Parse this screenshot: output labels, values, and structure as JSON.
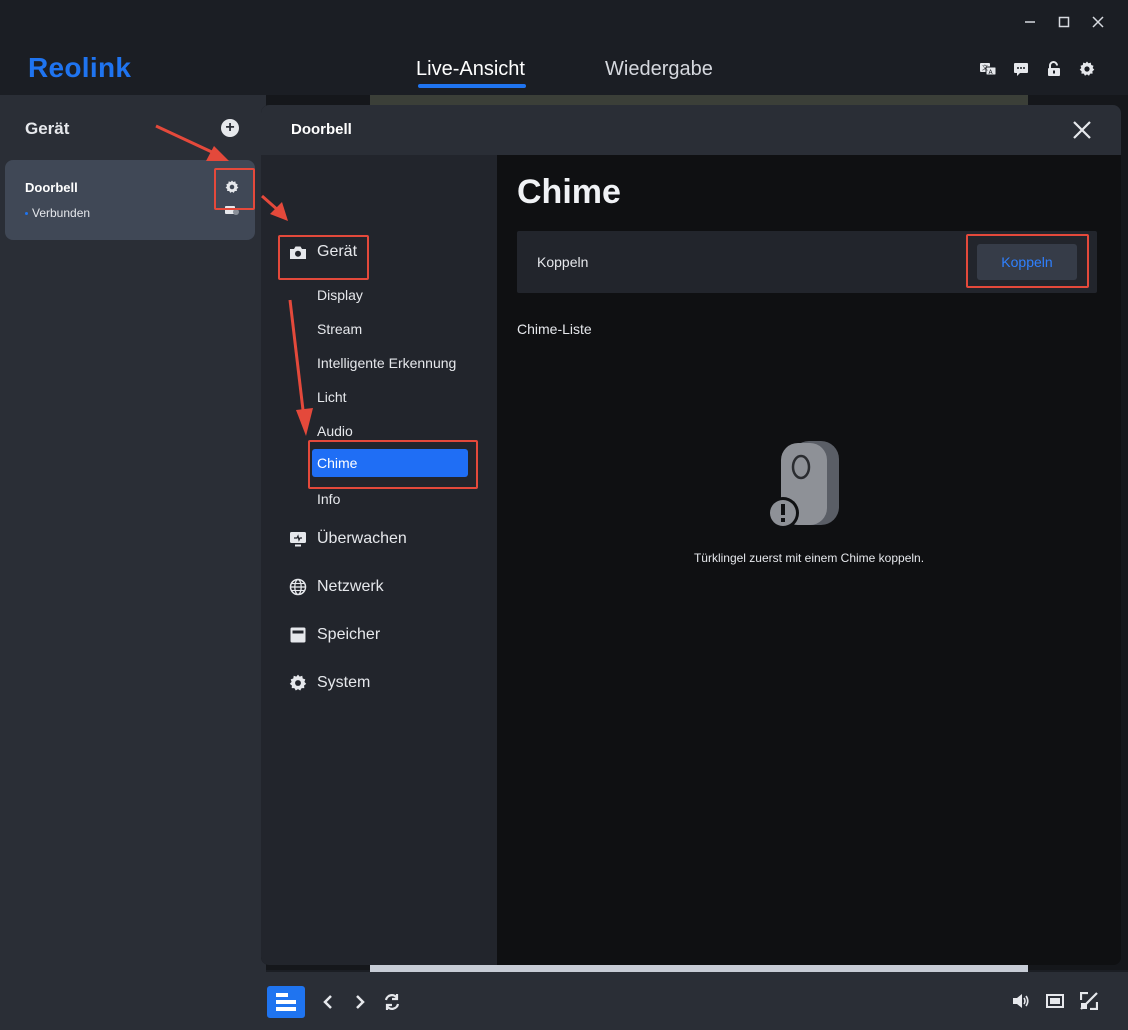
{
  "app": {
    "logo": "Reolink",
    "tabs": [
      {
        "label": "Live-Ansicht",
        "active": true
      },
      {
        "label": "Wiedergabe",
        "active": false
      }
    ],
    "accent_color": "#1f74f0"
  },
  "sidebar": {
    "title": "Gerät",
    "device": {
      "name": "Doorbell",
      "status": "Verbunden"
    }
  },
  "modal": {
    "title": "Doorbell",
    "nav": {
      "device_group": "Gerät",
      "device_items": [
        "Display",
        "Stream",
        "Intelligente Erkennung",
        "Licht",
        "Audio",
        "Chime",
        "Info"
      ],
      "active_item": "Chime",
      "groups": [
        "Überwachen",
        "Netzwerk",
        "Speicher",
        "System"
      ]
    },
    "content": {
      "title": "Chime",
      "pair_label": "Koppeln",
      "pair_button": "Koppeln",
      "list_title": "Chime-Liste",
      "empty_message": "Türklingel zuerst mit einem Chime koppeln."
    }
  },
  "annotation_color": "#e4493b"
}
